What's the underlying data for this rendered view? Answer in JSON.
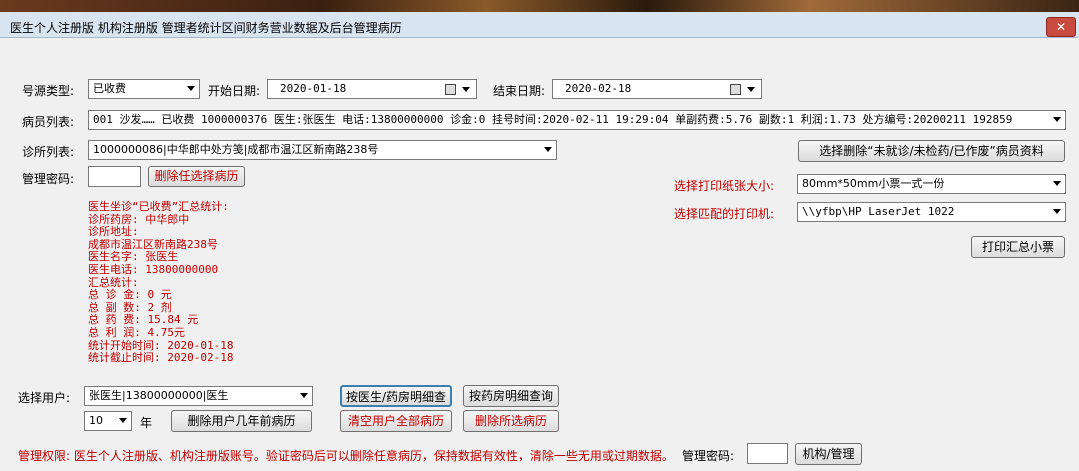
{
  "window": {
    "title": "医生个人注册版 机构注册版 管理者统计区间财务营业数据及后台管理病历",
    "close": "✕"
  },
  "filters": {
    "source_type_label": "号源类型:",
    "source_type_value": "已收费",
    "start_date_label": "开始日期:",
    "start_date_value": "2020-01-18",
    "end_date_label": "结束日期:",
    "end_date_value": "2020-02-18"
  },
  "patient_list": {
    "label": "病员列表:",
    "value": "001 沙发…… 已收费 1000000376 医生:张医生 电话:13800000000 诊金:0 挂号时间:2020-02-11 19:29:04 单副药费:5.76 副数:1 利润:1.73 处方编号:20200211 192859"
  },
  "clinic_list": {
    "label": "诊所列表:",
    "value": "1000000086|中华郎中处方笺|成都市温江区新南路238号"
  },
  "buttons": {
    "delete_unvisited": "选择删除“未就诊/未检药/已作废”病员资料",
    "delete_any": "删除任选择病历",
    "print_summary": "打印汇总小票",
    "doctor_pharmacy_detail": "按医生/药房明细查",
    "pharmacy_detail": "按药房明细查询",
    "delete_years_ago": "删除用户几年前病历",
    "clear_all": "清空用户全部病历",
    "delete_selected": "删除所选病历",
    "org_admin": "机构/管理"
  },
  "admin_password_label": "管理密码:",
  "print": {
    "paper_size_label": "选择打印纸张大小:",
    "paper_size_value": "80mm*50mm小票一式一份",
    "printer_label": "选择匹配的打印机:",
    "printer_value": "\\\\yfbp\\HP LaserJet 1022"
  },
  "summary": {
    "lines": [
      "医生坐诊“已收费”汇总统计:",
      "诊所药房: 中华郎中",
      "诊所地址:",
      "成都市温江区新南路238号",
      "医生名字: 张医生",
      "医生电话: 13800000000",
      "汇总统计:",
      "总 诊 金: 0 元",
      "总 副 数: 2 剂",
      "总 药 费: 15.84 元",
      "总 利 润: 4.75元",
      "统计开始时间: 2020-01-18",
      "统计截止时间: 2020-02-18"
    ]
  },
  "user": {
    "label": "选择用户:",
    "value": "张医生|13800000000|医生",
    "years_value": "10",
    "years_unit": "年"
  },
  "footer": {
    "note": "管理权限: 医生个人注册版、机构注册版账号。验证密码后可以删除任意病历，保持数据有效性，清除一些无用或过期数据。",
    "password_label": "管理密码:"
  }
}
